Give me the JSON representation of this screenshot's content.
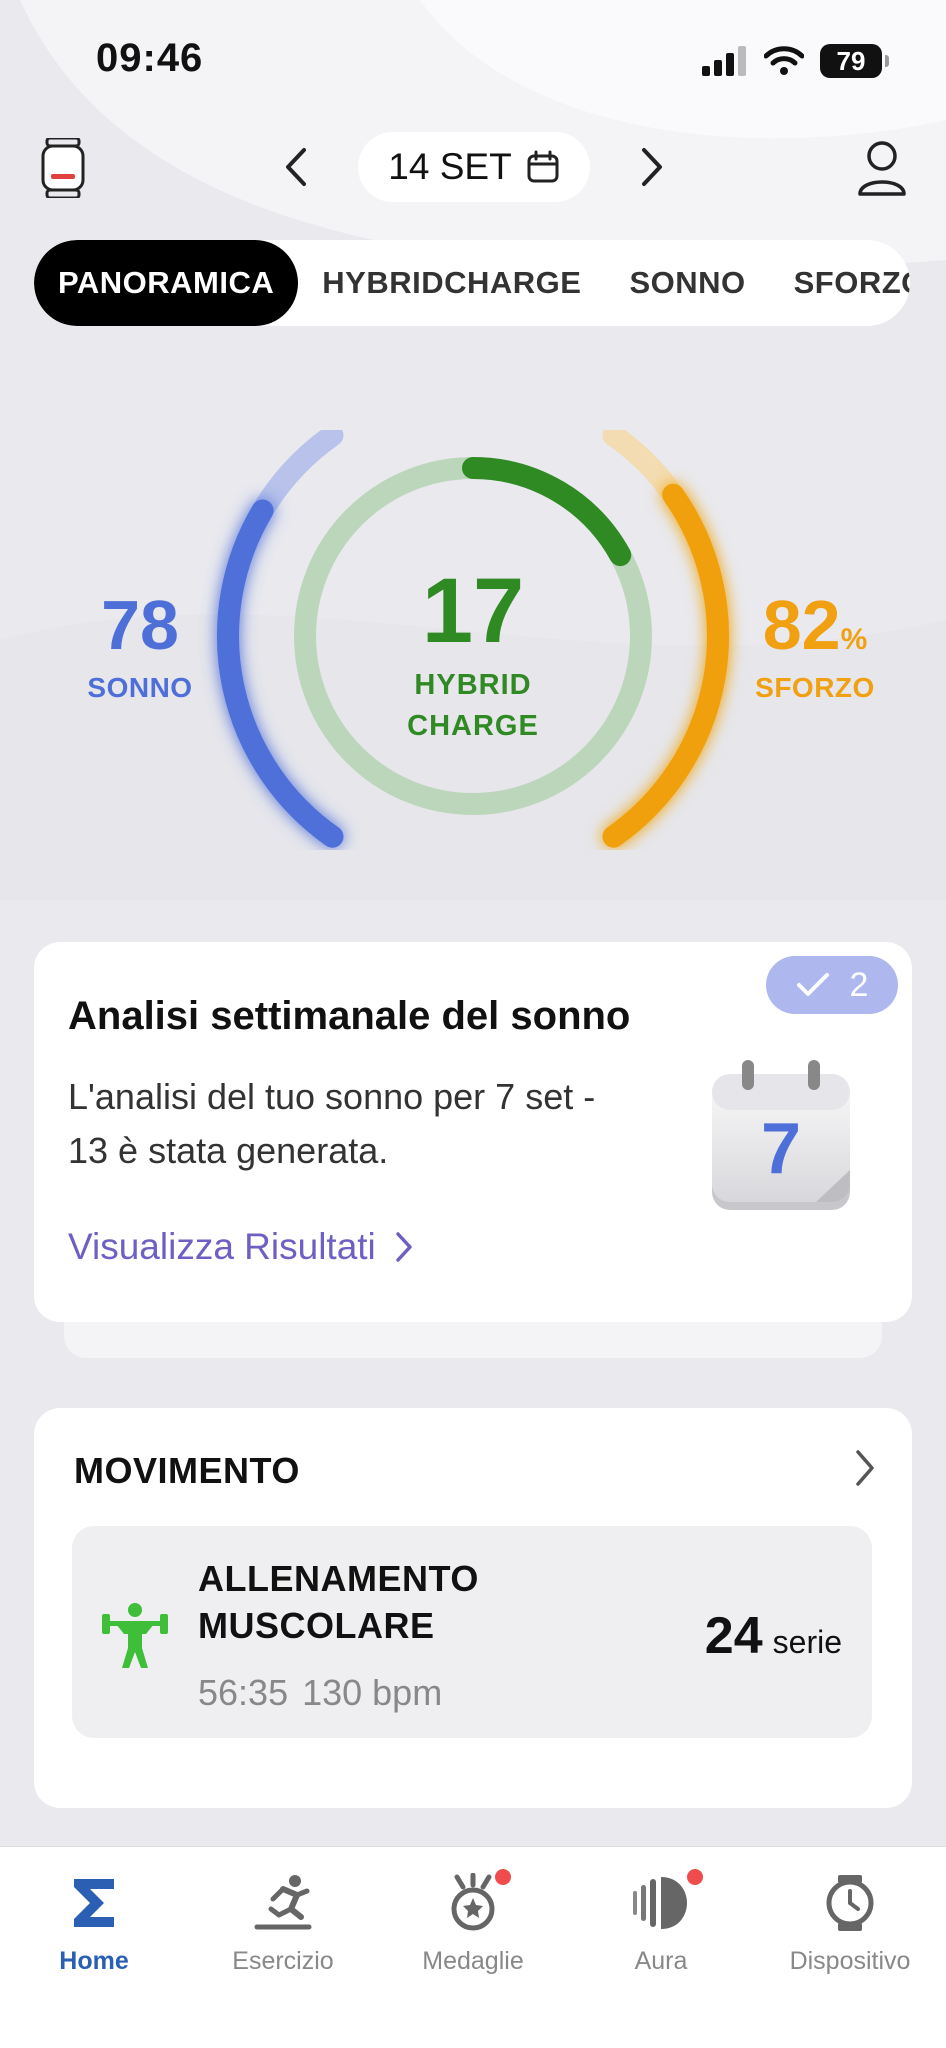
{
  "status_bar": {
    "time": "09:46",
    "battery": "79"
  },
  "header": {
    "date": "14 SET"
  },
  "tabs": [
    {
      "label": "PANORAMICA",
      "active": true
    },
    {
      "label": "HYBRIDCHARGE",
      "active": false
    },
    {
      "label": "SONNO",
      "active": false
    },
    {
      "label": "SFORZO",
      "active": false
    }
  ],
  "gauge": {
    "sleep": {
      "value": "78",
      "label": "SONNO",
      "color": "#4f6fd8",
      "level": 0.78
    },
    "hybrid": {
      "value": "17",
      "label_line1": "HYBRID",
      "label_line2": "CHARGE",
      "color": "#2f8a24",
      "level": 0.17
    },
    "effort": {
      "value": "82",
      "unit": "%",
      "label": "SFORZO",
      "color": "#f0a010",
      "level": 0.82
    }
  },
  "sleep_card": {
    "badge_count": "2",
    "title": "Analisi settimanale del sonno",
    "body": "L'analisi del tuo sonno per 7 set - 13 è stata generata.",
    "link": "Visualizza Risultati",
    "calendar_day": "7"
  },
  "movement": {
    "title": "MOVIMENTO",
    "activity": {
      "name": "ALLENAMENTO MUSCOLARE",
      "duration": "56:35",
      "heart_rate": "130 bpm",
      "count": "24",
      "unit": "serie"
    }
  },
  "bottom_nav": [
    {
      "label": "Home",
      "icon": "sigma-icon",
      "active": true,
      "dot": false
    },
    {
      "label": "Esercizio",
      "icon": "runner-icon",
      "active": false,
      "dot": false
    },
    {
      "label": "Medaglie",
      "icon": "medal-icon",
      "active": false,
      "dot": true
    },
    {
      "label": "Aura",
      "icon": "aura-icon",
      "active": false,
      "dot": true
    },
    {
      "label": "Dispositivo",
      "icon": "watch-icon",
      "active": false,
      "dot": false
    }
  ],
  "colors": {
    "accent": "#2b5fb3",
    "link": "#6d5fc4",
    "badge": "#aeb7ee"
  }
}
